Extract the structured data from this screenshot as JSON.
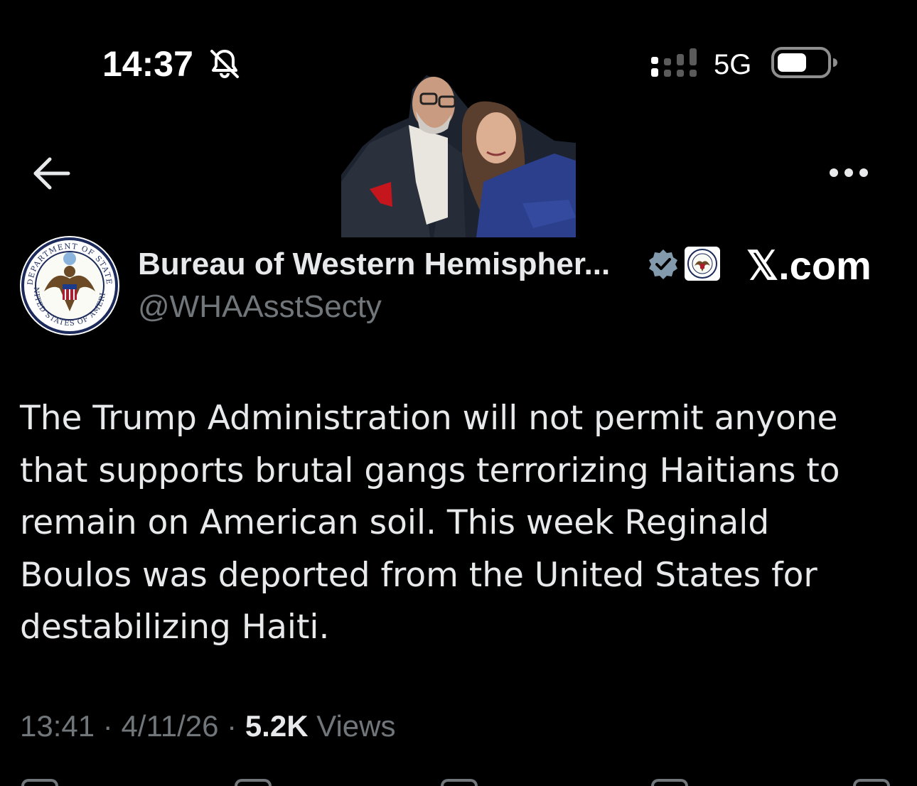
{
  "status_bar": {
    "time": "14:37",
    "network": "5G",
    "icons": [
      "bell-slash-icon",
      "signal-icon",
      "battery-icon"
    ]
  },
  "nav": {
    "back_icon": "arrow-left-icon",
    "more_icon": "more-horizontal-icon"
  },
  "watermark": "𝕏.com",
  "tweet": {
    "author": {
      "display_name": "Bureau of Western Hemispher...",
      "handle": "@WHAAsstSecty",
      "verified": true,
      "avatar_icon": "department-of-state-seal-icon",
      "avatar_text_top": "DEPARTMENT OF STATE",
      "avatar_text_bottom": "UNITED STATES OF AMERICA"
    },
    "text_lines": [
      "The Trump Administration will not permit anyone",
      "that supports brutal gangs terrorizing Haitians to",
      "remain on American soil. This week Reginald",
      "Boulos was deported from the United States for",
      "destabilizing Haiti."
    ],
    "meta": {
      "time": "13:41",
      "separator": "·",
      "date": "4/11/26",
      "views_count": "5.2K",
      "views_label": "Views"
    }
  },
  "colors": {
    "background": "#000000",
    "text_primary": "#e7e9ea",
    "text_secondary": "#71767b",
    "verified_blue": "#829aab"
  }
}
